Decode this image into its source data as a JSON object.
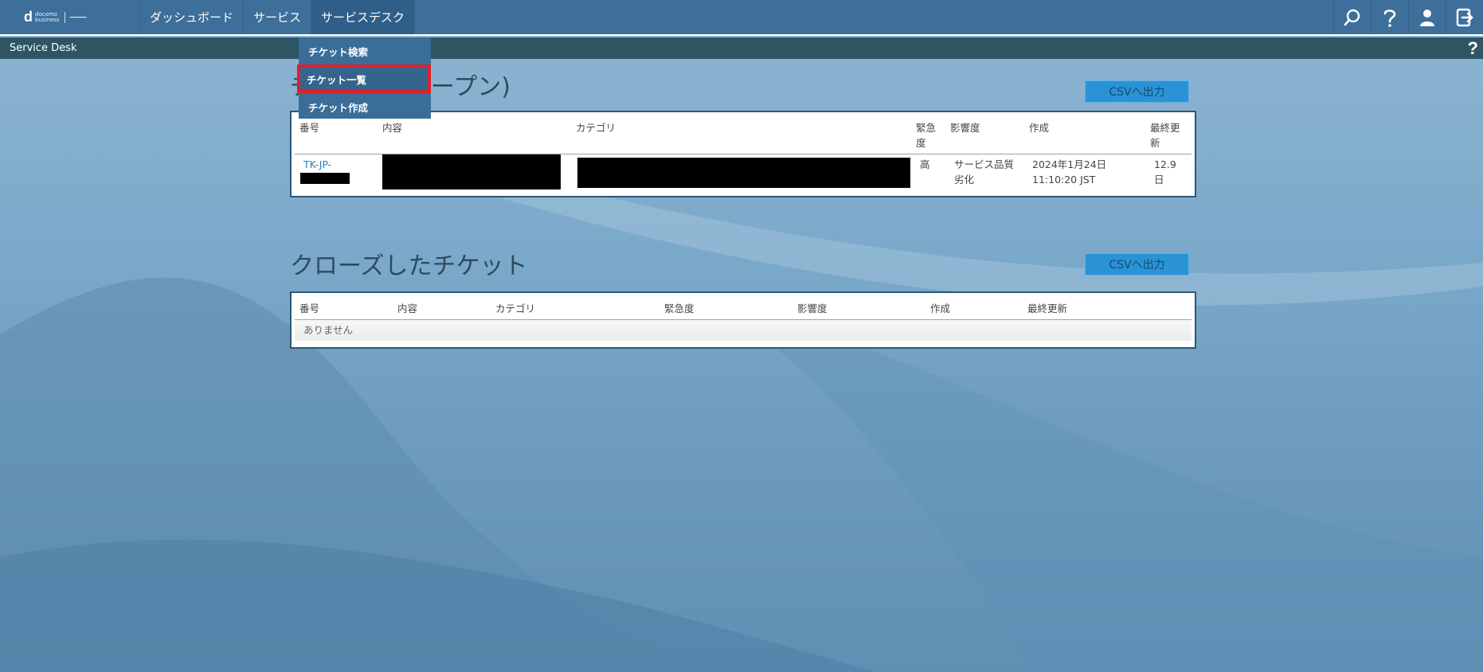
{
  "colors": {
    "topbar": "#3d6f9a",
    "subbar": "#2f5565",
    "accent": "#2a93d6",
    "highlight": "#e0202a"
  },
  "logo": {
    "mark": "d",
    "brand_line1": "docomo",
    "brand_line2": "business"
  },
  "nav": {
    "items": [
      {
        "label": "ダッシュボード"
      },
      {
        "label": "サービス"
      },
      {
        "label": "サービスデスク"
      }
    ],
    "icons": [
      "search-icon",
      "help-icon",
      "user-icon",
      "logout-icon"
    ]
  },
  "subbar": {
    "title": "Service Desk",
    "help": "?"
  },
  "dropdown": {
    "items": [
      {
        "label": "チケット検索"
      },
      {
        "label": "チケット一覧"
      },
      {
        "label": "チケット作成"
      }
    ]
  },
  "open_section": {
    "title_visible_part": "ープン)",
    "title_left_fragment": "チ",
    "csv_label": "CSVへ出力",
    "headers": [
      "番号",
      "内容",
      "カテゴリ",
      "緊急\n度",
      "影響度",
      "作成",
      "最終更\n新"
    ],
    "rows": [
      {
        "number_prefix": "TK-JP-",
        "urgency": "高",
        "impact": "サービス品質\n劣化",
        "created": "2024年1月24日\n11:10:20 JST",
        "updated": "12.9\n日"
      }
    ]
  },
  "closed_section": {
    "title": "クローズしたチケット",
    "csv_label": "CSVへ出力",
    "headers": [
      "番号",
      "内容",
      "カテゴリ",
      "緊急度",
      "影響度",
      "作成",
      "最終更新"
    ],
    "empty_text": "ありません"
  }
}
